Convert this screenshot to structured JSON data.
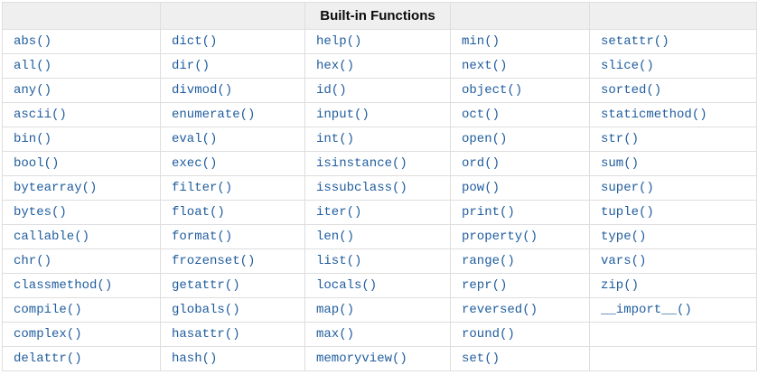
{
  "table": {
    "header": {
      "title": "Built-in Functions"
    },
    "rows": [
      [
        "abs()",
        "dict()",
        "help()",
        "min()",
        "setattr()"
      ],
      [
        "all()",
        "dir()",
        "hex()",
        "next()",
        "slice()"
      ],
      [
        "any()",
        "divmod()",
        "id()",
        "object()",
        "sorted()"
      ],
      [
        "ascii()",
        "enumerate()",
        "input()",
        "oct()",
        "staticmethod()"
      ],
      [
        "bin()",
        "eval()",
        "int()",
        "open()",
        "str()"
      ],
      [
        "bool()",
        "exec()",
        "isinstance()",
        "ord()",
        "sum()"
      ],
      [
        "bytearray()",
        "filter()",
        "issubclass()",
        "pow()",
        "super()"
      ],
      [
        "bytes()",
        "float()",
        "iter()",
        "print()",
        "tuple()"
      ],
      [
        "callable()",
        "format()",
        "len()",
        "property()",
        "type()"
      ],
      [
        "chr()",
        "frozenset()",
        "list()",
        "range()",
        "vars()"
      ],
      [
        "classmethod()",
        "getattr()",
        "locals()",
        "repr()",
        "zip()"
      ],
      [
        "compile()",
        "globals()",
        "map()",
        "reversed()",
        "__import__()"
      ],
      [
        "complex()",
        "hasattr()",
        "max()",
        "round()",
        ""
      ],
      [
        "delattr()",
        "hash()",
        "memoryview()",
        "set()",
        ""
      ]
    ],
    "colors": {
      "link": "#205d9e",
      "header_bg": "#efefef",
      "border": "#dedede",
      "title_text": "#0a0a0a"
    }
  }
}
